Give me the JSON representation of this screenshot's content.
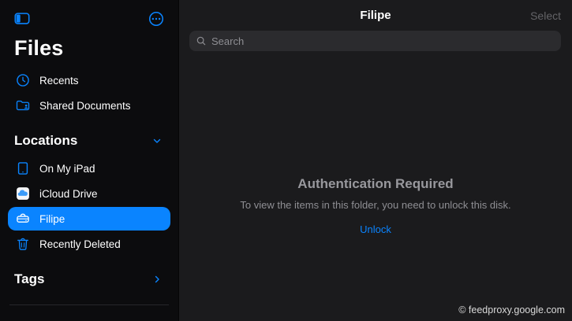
{
  "colors": {
    "accent": "#0a84ff",
    "sidebar_bg": "#0c0c0e",
    "main_bg": "#1b1b1d",
    "secondary_text": "#8e8e93"
  },
  "sidebar": {
    "title": "Files",
    "items_top": [
      {
        "label": "Recents",
        "icon": "clock-icon"
      },
      {
        "label": "Shared Documents",
        "icon": "shared-folder-icon"
      }
    ],
    "sections": [
      {
        "label": "Locations",
        "chevron": "down",
        "items": [
          {
            "label": "On My iPad",
            "icon": "ipad-icon",
            "selected": false
          },
          {
            "label": "iCloud Drive",
            "icon": "icloud-icon",
            "selected": false
          },
          {
            "label": "Filipe",
            "icon": "external-drive-icon",
            "selected": true
          },
          {
            "label": "Recently Deleted",
            "icon": "trash-icon",
            "selected": false
          }
        ]
      },
      {
        "label": "Tags",
        "chevron": "right",
        "items": []
      }
    ]
  },
  "header": {
    "title": "Filipe",
    "select_label": "Select"
  },
  "search": {
    "placeholder": "Search"
  },
  "main": {
    "empty_state": {
      "title": "Authentication Required",
      "message": "To view the items in this folder, you need to unlock this disk.",
      "action_label": "Unlock"
    }
  },
  "watermark": "© feedproxy.google.com"
}
